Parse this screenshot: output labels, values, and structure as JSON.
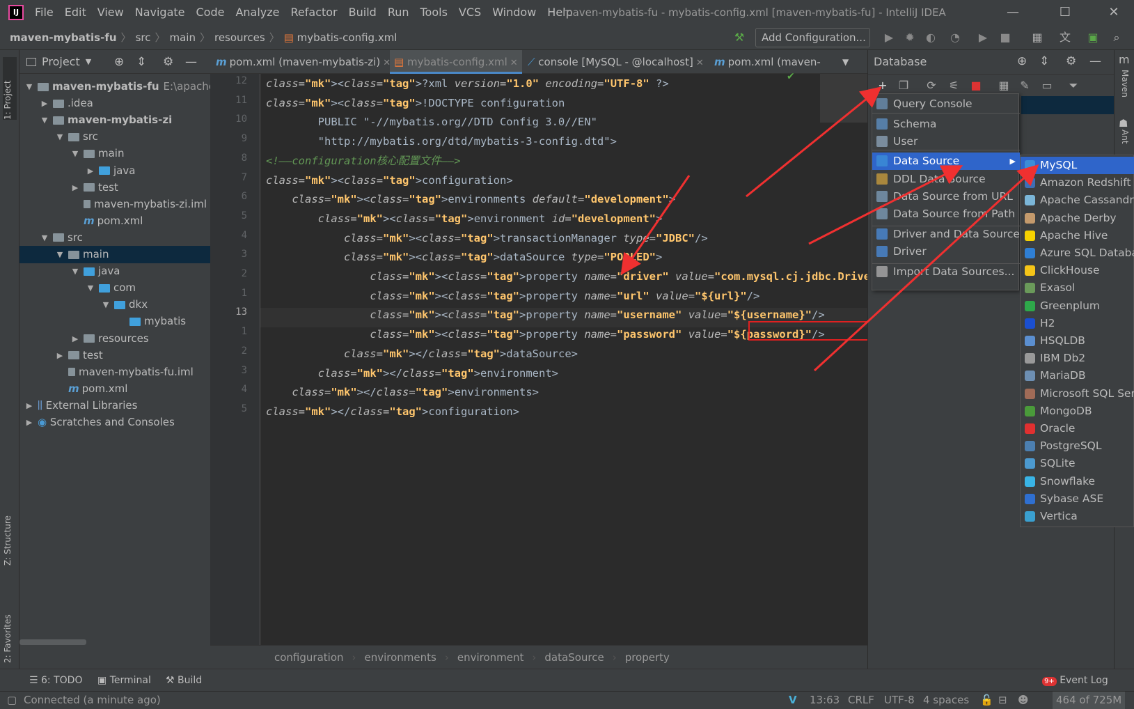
{
  "menubar": {
    "items": [
      "File",
      "Edit",
      "View",
      "Navigate",
      "Code",
      "Analyze",
      "Refactor",
      "Build",
      "Run",
      "Tools",
      "VCS",
      "Window",
      "Help"
    ],
    "title": "maven-mybatis-fu - mybatis-config.xml [maven-mybatis-fu] - IntelliJ IDEA"
  },
  "nav": {
    "crumbs": [
      "maven-mybatis-fu",
      "src",
      "main",
      "resources",
      "mybatis-config.xml"
    ],
    "add_config": "Add Configuration..."
  },
  "left_strip": {
    "project": "1: Project",
    "structure": "Z: Structure",
    "favorites": "2: Favorites"
  },
  "right_strip": {
    "maven": "Maven",
    "ant": "Ant"
  },
  "project": {
    "title": "Project",
    "tree": [
      {
        "label": "maven-mybatis-fu",
        "extra": "E:\\apache-",
        "depth": 0,
        "open": true,
        "bold": true
      },
      {
        "label": ".idea",
        "depth": 1,
        "open": false
      },
      {
        "label": "maven-mybatis-zi",
        "depth": 1,
        "open": true,
        "bold": true
      },
      {
        "label": "src",
        "depth": 2,
        "open": true
      },
      {
        "label": "main",
        "depth": 3,
        "open": true
      },
      {
        "label": "java",
        "depth": 4,
        "open": false
      },
      {
        "label": "test",
        "depth": 3,
        "open": false
      },
      {
        "label": "maven-mybatis-zi.iml",
        "depth": 3
      },
      {
        "label": "pom.xml",
        "depth": 3
      },
      {
        "label": "src",
        "depth": 1,
        "open": true
      },
      {
        "label": "main",
        "depth": 2,
        "open": true,
        "selected": true
      },
      {
        "label": "java",
        "depth": 3,
        "open": true
      },
      {
        "label": "com",
        "depth": 4,
        "open": true
      },
      {
        "label": "dkx",
        "depth": 5,
        "open": true
      },
      {
        "label": "mybatis",
        "depth": 6
      },
      {
        "label": "resources",
        "depth": 3,
        "open": false
      },
      {
        "label": "test",
        "depth": 2,
        "open": false
      },
      {
        "label": "maven-mybatis-fu.iml",
        "depth": 2
      },
      {
        "label": "pom.xml",
        "depth": 2
      },
      {
        "label": "External Libraries",
        "depth": 0,
        "open": false
      },
      {
        "label": "Scratches and Consoles",
        "depth": 0,
        "open": false
      }
    ]
  },
  "tabs": [
    "pom.xml (maven-mybatis-zi)",
    "mybatis-config.xml",
    "console [MySQL - @localhost]",
    "pom.xml (maven-"
  ],
  "editor": {
    "line_numbers": [
      "12",
      "11",
      "10",
      "9",
      "8",
      "7",
      "6",
      "5",
      "4",
      "3",
      "2",
      "1",
      "13",
      "1",
      "2",
      "3",
      "4",
      "5"
    ],
    "lines": [
      "<?xml version=\"1.0\" encoding=\"UTF-8\" ?>",
      "<!DOCTYPE configuration",
      "        PUBLIC \"-//mybatis.org//DTD Config 3.0//EN\"",
      "        \"http://mybatis.org/dtd/mybatis-3-config.dtd\">",
      "<!——configuration核心配置文件——>",
      "<configuration>",
      "    <environments default=\"development\">",
      "        <environment id=\"development\">",
      "            <transactionManager type=\"JDBC\"/>",
      "            <dataSource type=\"POOLED\">",
      "                <property name=\"driver\" value=\"com.mysql.cj.jdbc.Driver\"/>",
      "                <property name=\"url\" value=\"${url}\"/>",
      "                <property name=\"username\" value=\"${username}\"/>",
      "                <property name=\"password\" value=\"${password}\"/>",
      "            </dataSource>",
      "        </environment>",
      "    </environments>",
      "</configuration>"
    ],
    "breadcrumbs": [
      "configuration",
      "environments",
      "environment",
      "dataSource",
      "property"
    ]
  },
  "database": {
    "title": "Database",
    "menu": [
      "Query Console",
      "Schema",
      "User",
      "Data Source",
      "DDL Data Source",
      "Data Source from URL",
      "Data Source from Path",
      "Driver and Data Source",
      "Driver",
      "Import Data Sources..."
    ],
    "sources": [
      "MySQL",
      "Amazon Redshift",
      "Apache Cassandra",
      "Apache Derby",
      "Apache Hive",
      "Azure SQL Database",
      "ClickHouse",
      "Exasol",
      "Greenplum",
      "H2",
      "HSQLDB",
      "IBM Db2",
      "MariaDB",
      "Microsoft SQL Server",
      "MongoDB",
      "Oracle",
      "PostgreSQL",
      "SQLite",
      "Snowflake",
      "Sybase ASE",
      "Vertica"
    ],
    "colors": [
      "#3c8dd6",
      "#3d6fb6",
      "#7bb6d8",
      "#c49a6c",
      "#f6d200",
      "#2f7fd4",
      "#f5c518",
      "#6a9a5a",
      "#2ea84a",
      "#1b4fd0",
      "#5b8fd0",
      "#999999",
      "#6d8fb3",
      "#a06b57",
      "#4a9a3a",
      "#e03030",
      "#4c7fb0",
      "#4c9ad0",
      "#39b4e6",
      "#2f6fd0",
      "#3aa0d0"
    ]
  },
  "bottom": {
    "todo": "6: TODO",
    "terminal": "Terminal",
    "build": "Build",
    "event_log": "Event Log",
    "event_badge": "9+"
  },
  "status": {
    "connected": "Connected (a minute ago)",
    "position": "13:63",
    "line_sep": "CRLF",
    "encoding": "UTF-8",
    "indent": "4 spaces",
    "memory": "464 of 725M"
  }
}
